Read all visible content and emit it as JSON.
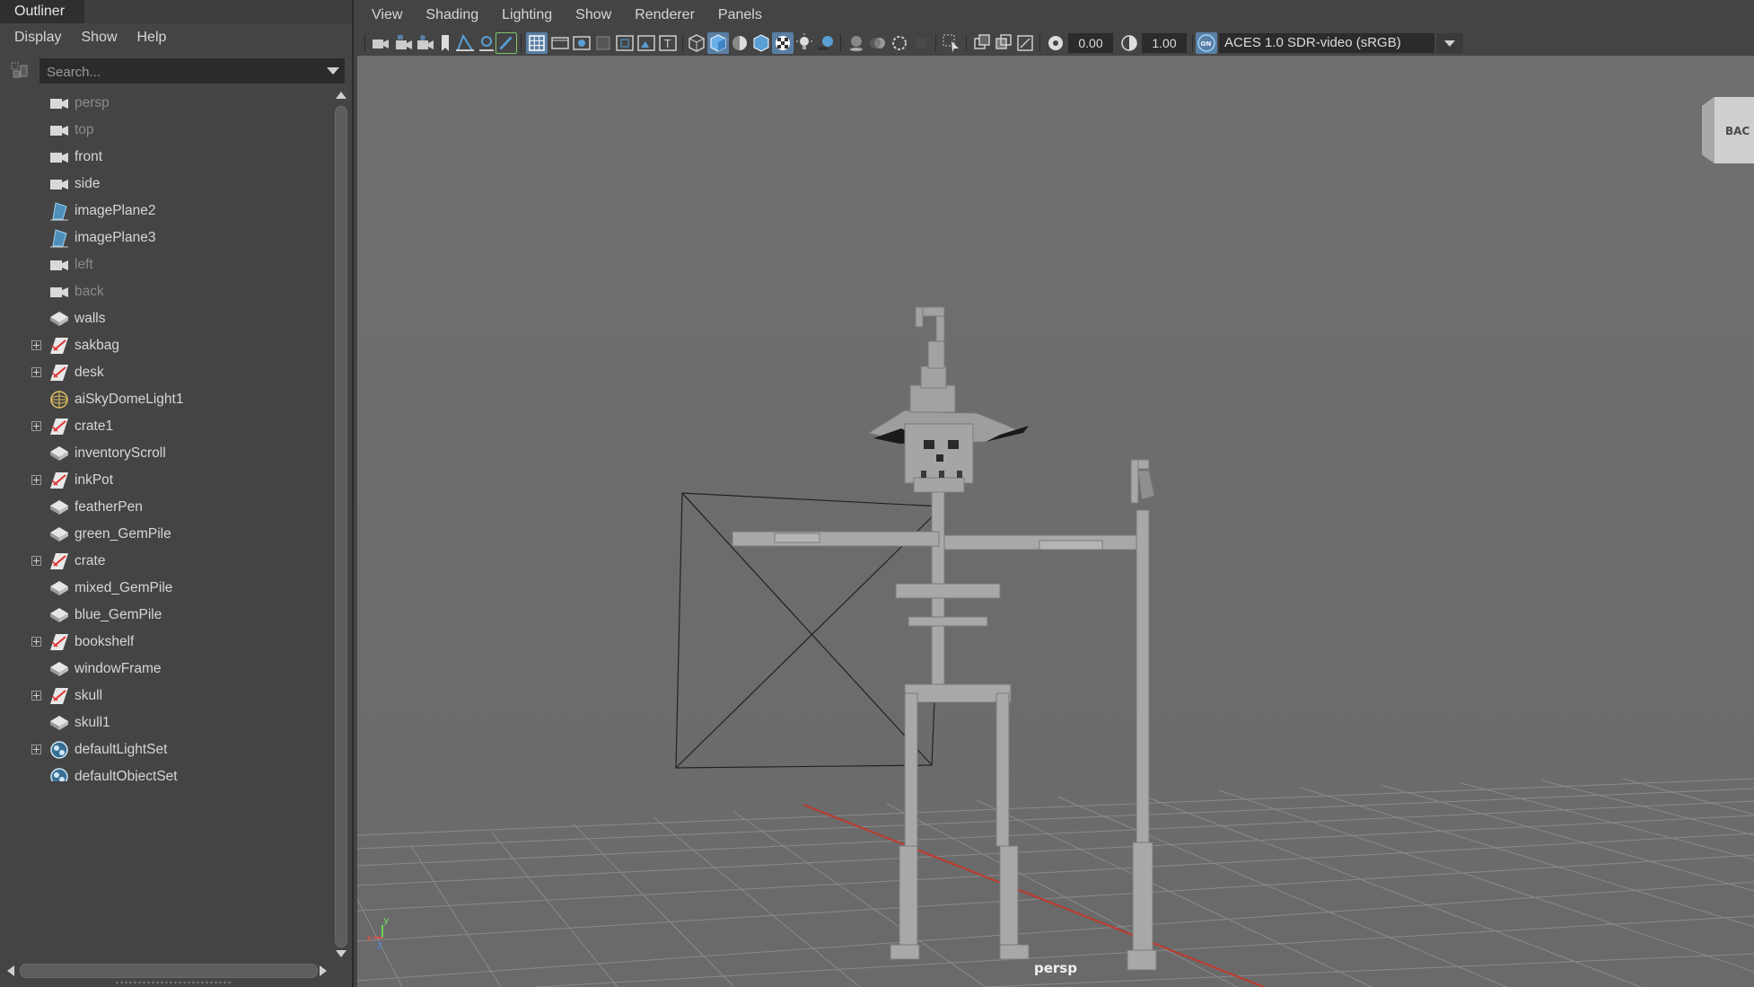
{
  "outliner": {
    "title": "Outliner",
    "menu": [
      "Display",
      "Show",
      "Help"
    ],
    "search_placeholder": "Search...",
    "items": [
      {
        "label": "persp",
        "icon": "camera-icon",
        "dim": true,
        "expandable": false
      },
      {
        "label": "top",
        "icon": "camera-icon",
        "dim": true,
        "expandable": false
      },
      {
        "label": "front",
        "icon": "camera-icon",
        "dim": false,
        "expandable": false
      },
      {
        "label": "side",
        "icon": "camera-icon",
        "dim": false,
        "expandable": false
      },
      {
        "label": "imagePlane2",
        "icon": "image-plane-icon",
        "dim": false,
        "expandable": false
      },
      {
        "label": "imagePlane3",
        "icon": "image-plane-icon",
        "dim": false,
        "expandable": false
      },
      {
        "label": "left",
        "icon": "camera-icon",
        "dim": true,
        "expandable": false
      },
      {
        "label": "back",
        "icon": "camera-icon",
        "dim": true,
        "expandable": false
      },
      {
        "label": "walls",
        "icon": "mesh-icon",
        "dim": false,
        "expandable": false
      },
      {
        "label": "sakbag",
        "icon": "group-icon",
        "dim": false,
        "expandable": true
      },
      {
        "label": "desk",
        "icon": "group-icon",
        "dim": false,
        "expandable": true
      },
      {
        "label": "aiSkyDomeLight1",
        "icon": "skydome-light-icon",
        "dim": false,
        "expandable": false
      },
      {
        "label": "crate1",
        "icon": "group-icon",
        "dim": false,
        "expandable": true
      },
      {
        "label": "inventoryScroll",
        "icon": "mesh-icon",
        "dim": false,
        "expandable": false
      },
      {
        "label": "inkPot",
        "icon": "group-icon",
        "dim": false,
        "expandable": true
      },
      {
        "label": "featherPen",
        "icon": "mesh-icon",
        "dim": false,
        "expandable": false
      },
      {
        "label": "green_GemPile",
        "icon": "mesh-icon",
        "dim": false,
        "expandable": false
      },
      {
        "label": "crate",
        "icon": "group-icon",
        "dim": false,
        "expandable": true
      },
      {
        "label": "mixed_GemPile",
        "icon": "mesh-icon",
        "dim": false,
        "expandable": false
      },
      {
        "label": "blue_GemPile",
        "icon": "mesh-icon",
        "dim": false,
        "expandable": false
      },
      {
        "label": "bookshelf",
        "icon": "group-icon",
        "dim": false,
        "expandable": true
      },
      {
        "label": "windowFrame",
        "icon": "mesh-icon",
        "dim": false,
        "expandable": false
      },
      {
        "label": "skull",
        "icon": "group-icon",
        "dim": false,
        "expandable": true
      },
      {
        "label": "skull1",
        "icon": "mesh-icon",
        "dim": false,
        "expandable": false
      },
      {
        "label": "defaultLightSet",
        "icon": "set-icon",
        "dim": false,
        "expandable": true
      },
      {
        "label": "defaultObjectSet",
        "icon": "set-icon",
        "dim": false,
        "expandable": false
      }
    ]
  },
  "viewport": {
    "menu": [
      "View",
      "Shading",
      "Lighting",
      "Show",
      "Renderer",
      "Panels"
    ],
    "exposure": "0.00",
    "gamma": "1.00",
    "color_management": "ACES 1.0 SDR-video (sRGB)",
    "camera_label": "persp",
    "viewcube_label": "BAC",
    "axis_labels": {
      "x": "x",
      "y": "y",
      "z": "z"
    },
    "colors": {
      "background": "#6f6f6f",
      "accent": "#5a7fa5",
      "x_axis": "#c0392b"
    }
  }
}
